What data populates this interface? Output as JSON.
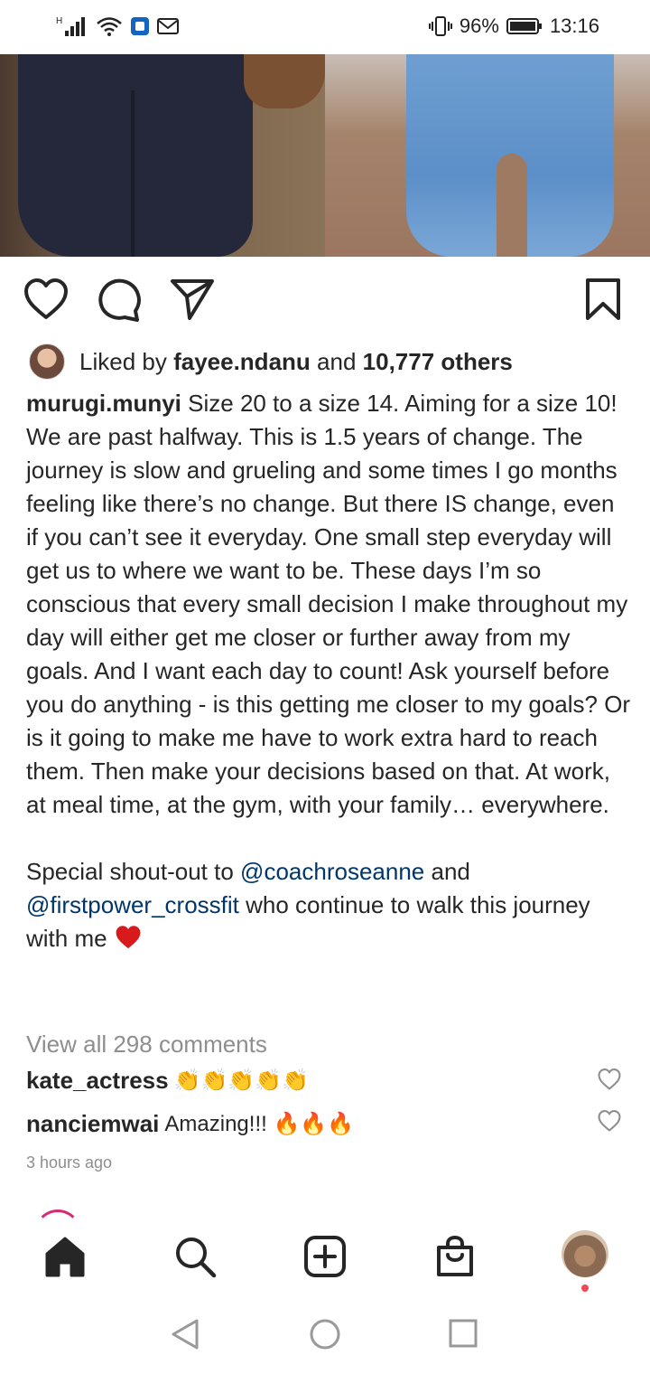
{
  "status_bar": {
    "battery": "96%",
    "time": "13:16"
  },
  "post": {
    "liked_by_prefix": "Liked by",
    "liked_by_user": "fayee.ndanu",
    "liked_by_and": "and",
    "liked_by_others": "10,777 others",
    "author": "murugi.munyi",
    "caption_p1": "Size 20 to a size 14. Aiming for a size 10! We are past halfway. This is 1.5 years of change. The journey is slow and grueling and some times I go months feeling like there’s no change. But there IS change, even if you can’t see it everyday. One small step everyday will get us to where we want to be. These days I’m so conscious that every small decision I make throughout my day will either get me closer or further away from my goals. And I want each day to count! Ask yourself before you do anything - is this getting me closer to my goals? Or is it going to make me have to work extra hard to reach them. Then make your decisions based on that. At work, at meal time, at the gym, with your family… everywhere.",
    "caption_p2_prefix": "Special shout-out to",
    "mention_1": "@coachroseanne",
    "caption_p2_and": "and",
    "mention_2": "@firstpower_crossfit",
    "caption_p2_suffix": "who continue to walk this journey with me",
    "view_all_comments": "View all 298 comments",
    "comments": [
      {
        "user": "kate_actress",
        "text": "👏👏👏👏👏"
      },
      {
        "user": "nanciemwai",
        "text": "Amazing!!! 🔥🔥🔥"
      }
    ],
    "time_ago": "3 hours ago"
  },
  "icons": {
    "like": "heart-outline-icon",
    "comment": "comment-bubble-icon",
    "share": "paper-plane-icon",
    "save": "bookmark-icon"
  },
  "colors": {
    "mention": "#00376b",
    "muted": "#8e8e8e",
    "text": "#262626",
    "notification_dot": "#ed4956"
  }
}
